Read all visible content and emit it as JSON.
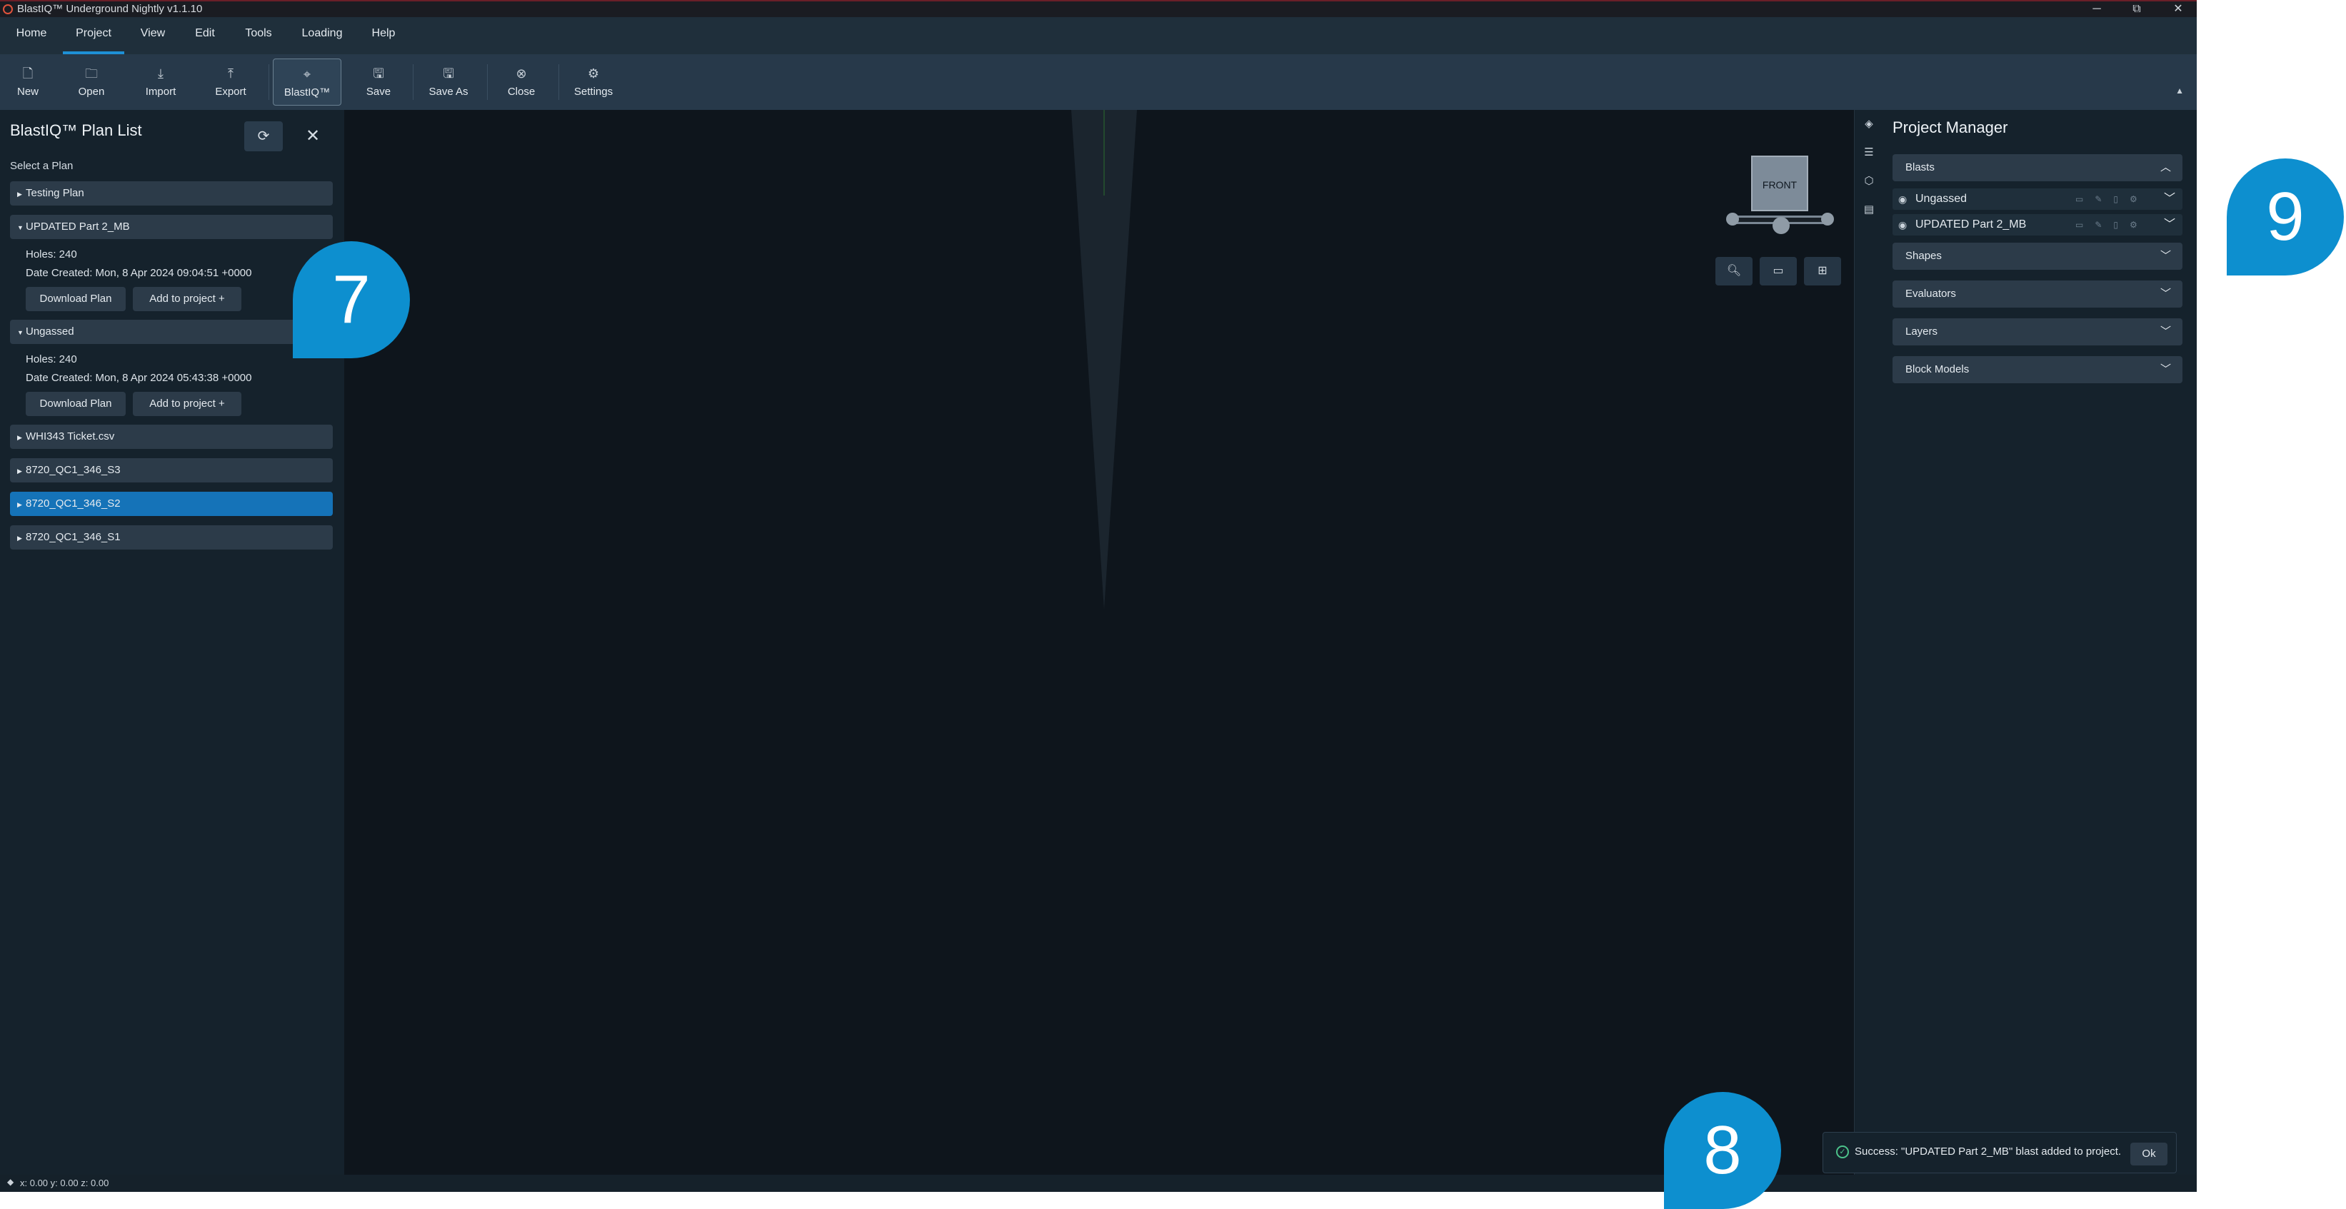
{
  "window": {
    "title": "BlastIQ™ Underground Nightly v1.1.10",
    "minimize": "─",
    "restore": "⧉",
    "close": "✕"
  },
  "menu": [
    "Home",
    "Project",
    "View",
    "Edit",
    "Tools",
    "Loading",
    "Help"
  ],
  "toolbar": {
    "new": "New",
    "open": "Open",
    "import": "Import",
    "export": "Export",
    "blastiq": "BlastIQ™",
    "save": "Save",
    "save_as": "Save As",
    "close": "Close",
    "settings": "Settings",
    "collapse": "▲"
  },
  "plan_list": {
    "title": "BlastIQ™ Plan List",
    "select_label": "Select a Plan",
    "plans": [
      {
        "name": "Testing Plan",
        "expanded": false
      },
      {
        "name": "UPDATED Part 2_MB",
        "expanded": true,
        "holes": "Holes: 240",
        "date": "Date Created: Mon, 8 Apr 2024 09:04:51 +0000"
      },
      {
        "name": "Ungassed",
        "expanded": true,
        "holes": "Holes: 240",
        "date": "Date Created: Mon, 8 Apr 2024 05:43:38 +0000"
      },
      {
        "name": "WHI343 Ticket.csv",
        "expanded": false
      },
      {
        "name": "8720_QC1_346_S3",
        "expanded": false
      },
      {
        "name": "8720_QC1_346_S2",
        "expanded": false,
        "selected": true
      },
      {
        "name": "8720_QC1_346_S1",
        "expanded": false
      }
    ],
    "download_label": "Download Plan",
    "add_label": "Add to project +"
  },
  "viewport": {
    "gizmo_label": "FRONT"
  },
  "project_manager": {
    "title": "Project Manager",
    "blasts_label": "Blasts",
    "blasts": [
      "Ungassed",
      "UPDATED Part 2_MB"
    ],
    "sections": [
      "Shapes",
      "Evaluators",
      "Layers",
      "Block Models"
    ]
  },
  "status": {
    "coords": "x: 0.00 y: 0.00 z: 0.00"
  },
  "toast": {
    "message": "Success:  \"UPDATED Part 2_MB\" blast added to project.",
    "ok": "Ok"
  },
  "callouts": {
    "seven": "7",
    "eight": "8",
    "nine": "9"
  },
  "colors": {
    "accent": "#1e90d6",
    "selected_row": "#1573b8",
    "callout": "#0d8fcf",
    "success": "#4cc28a"
  }
}
